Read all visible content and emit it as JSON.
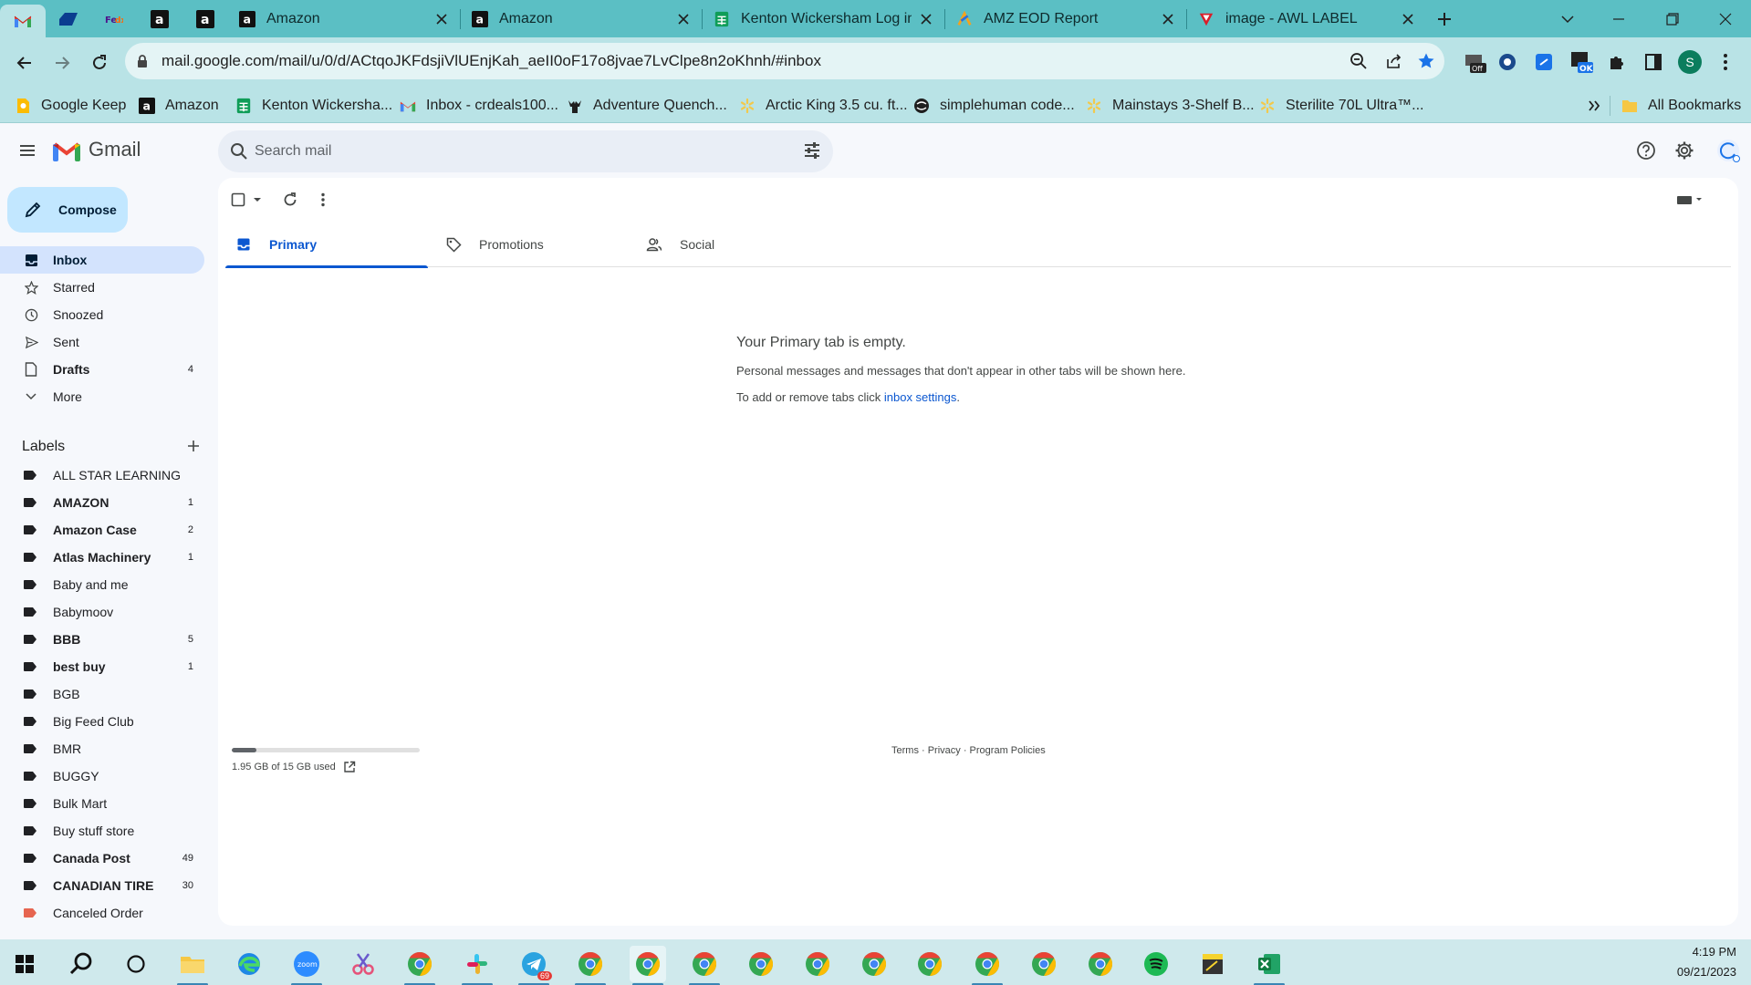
{
  "browser": {
    "tabs": [
      {
        "title": "Amazon",
        "favicon": "amazon-icon"
      },
      {
        "title": "Amazon",
        "favicon": "amazon-icon"
      },
      {
        "title": "Kenton Wickersham Log ins",
        "favicon": "google-sheets-icon"
      },
      {
        "title": "AMZ EOD Report",
        "favicon": "zapier-style-icon"
      },
      {
        "title": "image - AWL LABEL",
        "favicon": "red-logo-icon"
      }
    ],
    "pinned_tabs": [
      "gmail-icon",
      "blue-brand-icon",
      "fedex-icon",
      "amazon-icon",
      "amazon-icon"
    ],
    "url": "mail.google.com/mail/u/0/d/ACtqoJKFdsjiVlUEnjKah_aeII0oF17o8jvae7LvClpe8n2oKhnh/#inbox",
    "profile_initial": "S",
    "bookmarks": [
      {
        "label": "Google Keep",
        "icon": "keep-icon"
      },
      {
        "label": "Amazon",
        "icon": "amazon-icon"
      },
      {
        "label": "Kenton Wickersha...",
        "icon": "google-sheets-icon"
      },
      {
        "label": "Inbox - crdeals100...",
        "icon": "gmail-icon"
      },
      {
        "label": "Adventure Quench...",
        "icon": "moose-icon"
      },
      {
        "label": "Arctic King 3.5 cu. ft...",
        "icon": "walmart-icon"
      },
      {
        "label": "simplehuman code...",
        "icon": "globe-icon"
      },
      {
        "label": "Mainstays 3-Shelf B...",
        "icon": "walmart-icon"
      },
      {
        "label": "Sterilite 70L Ultra™...",
        "icon": "walmart-icon"
      }
    ],
    "all_bookmarks": "All Bookmarks"
  },
  "gmail": {
    "brand": "Gmail",
    "search_placeholder": "Search mail",
    "compose": "Compose",
    "nav": [
      {
        "label": "Inbox",
        "count": "",
        "active": true
      },
      {
        "label": "Starred",
        "count": ""
      },
      {
        "label": "Snoozed",
        "count": ""
      },
      {
        "label": "Sent",
        "count": ""
      },
      {
        "label": "Drafts",
        "count": "4"
      },
      {
        "label": "More",
        "count": ""
      }
    ],
    "labels_title": "Labels",
    "labels": [
      {
        "label": "ALL STAR LEARNING",
        "count": "",
        "bold": false
      },
      {
        "label": "AMAZON",
        "count": "1",
        "bold": true
      },
      {
        "label": "Amazon Case",
        "count": "2",
        "bold": true
      },
      {
        "label": "Atlas Machinery",
        "count": "1",
        "bold": true
      },
      {
        "label": "Baby and me",
        "count": "",
        "bold": false
      },
      {
        "label": "Babymoov",
        "count": "",
        "bold": false
      },
      {
        "label": "BBB",
        "count": "5",
        "bold": true
      },
      {
        "label": "best buy",
        "count": "1",
        "bold": true
      },
      {
        "label": "BGB",
        "count": "",
        "bold": false
      },
      {
        "label": "Big Feed Club",
        "count": "",
        "bold": false
      },
      {
        "label": "BMR",
        "count": "",
        "bold": false
      },
      {
        "label": "BUGGY",
        "count": "",
        "bold": false
      },
      {
        "label": "Bulk Mart",
        "count": "",
        "bold": false
      },
      {
        "label": "Buy stuff store",
        "count": "",
        "bold": false
      },
      {
        "label": "Canada Post",
        "count": "49",
        "bold": true
      },
      {
        "label": "CANADIAN TIRE",
        "count": "30",
        "bold": true
      },
      {
        "label": "Canceled Order",
        "count": "",
        "bold": false,
        "color": "#e66550"
      }
    ],
    "inbox_tabs": [
      {
        "label": "Primary",
        "active": true
      },
      {
        "label": "Promotions"
      },
      {
        "label": "Social"
      }
    ],
    "empty_title": "Your Primary tab is empty.",
    "empty_line1": "Personal messages and messages that don't appear in other tabs will be shown here.",
    "empty_line2_prefix": "To add or remove tabs click ",
    "empty_line2_link": "inbox settings",
    "empty_line2_suffix": ".",
    "storage_text": "1.95 GB of 15 GB used",
    "storage_fraction": 0.13,
    "footer": "Terms · Privacy · Program Policies"
  },
  "taskbar": {
    "time": "4:19 PM",
    "date": "09/21/2023",
    "telegram_badge": "69"
  }
}
